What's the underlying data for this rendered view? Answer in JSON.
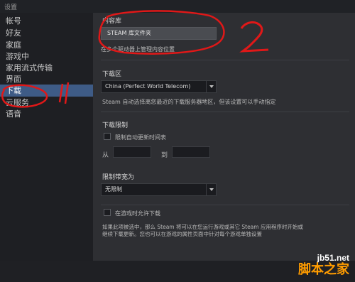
{
  "window": {
    "title": "设置"
  },
  "sidebar": {
    "items": [
      {
        "label": "帐号"
      },
      {
        "label": "好友"
      },
      {
        "label": "家庭"
      },
      {
        "label": "游戏中"
      },
      {
        "label": "家用流式传输"
      },
      {
        "label": "界面"
      },
      {
        "label": "下载",
        "active": true
      },
      {
        "label": "云服务"
      },
      {
        "label": "语音"
      }
    ]
  },
  "content": {
    "library": {
      "label": "内容库",
      "button": "STEAM 库文件夹",
      "description": "在多个驱动器上管理内容位置"
    },
    "download_region": {
      "label": "下载区",
      "selected": "China (Perfect World Telecom)",
      "description": "Steam 自动选择离您最近的下载服务器地区，但该设置可以手动指定"
    },
    "download_limit": {
      "label": "下载限制",
      "checkbox_label": "限制自动更新时间表",
      "checked": false,
      "from_label": "从",
      "to_label": "到",
      "from_value": "",
      "to_value": ""
    },
    "bandwidth": {
      "label": "限制带宽为",
      "selected": "无限制"
    },
    "gameplay": {
      "checkbox_label": "在游戏时允许下载",
      "checked": false,
      "description_line1": "如果此项被选中，那么 Steam 将可以在您运行游戏或其它 Steam 应用程序时开始或",
      "description_line2": "继续下载更新。您也可以在游戏的属性页面中针对每个游戏单独设置"
    }
  },
  "annotations": {
    "color": "#e01818",
    "mark_1": "1",
    "mark_2": "2"
  },
  "watermark": {
    "url": "jb51.net",
    "brand": "脚本之家"
  }
}
